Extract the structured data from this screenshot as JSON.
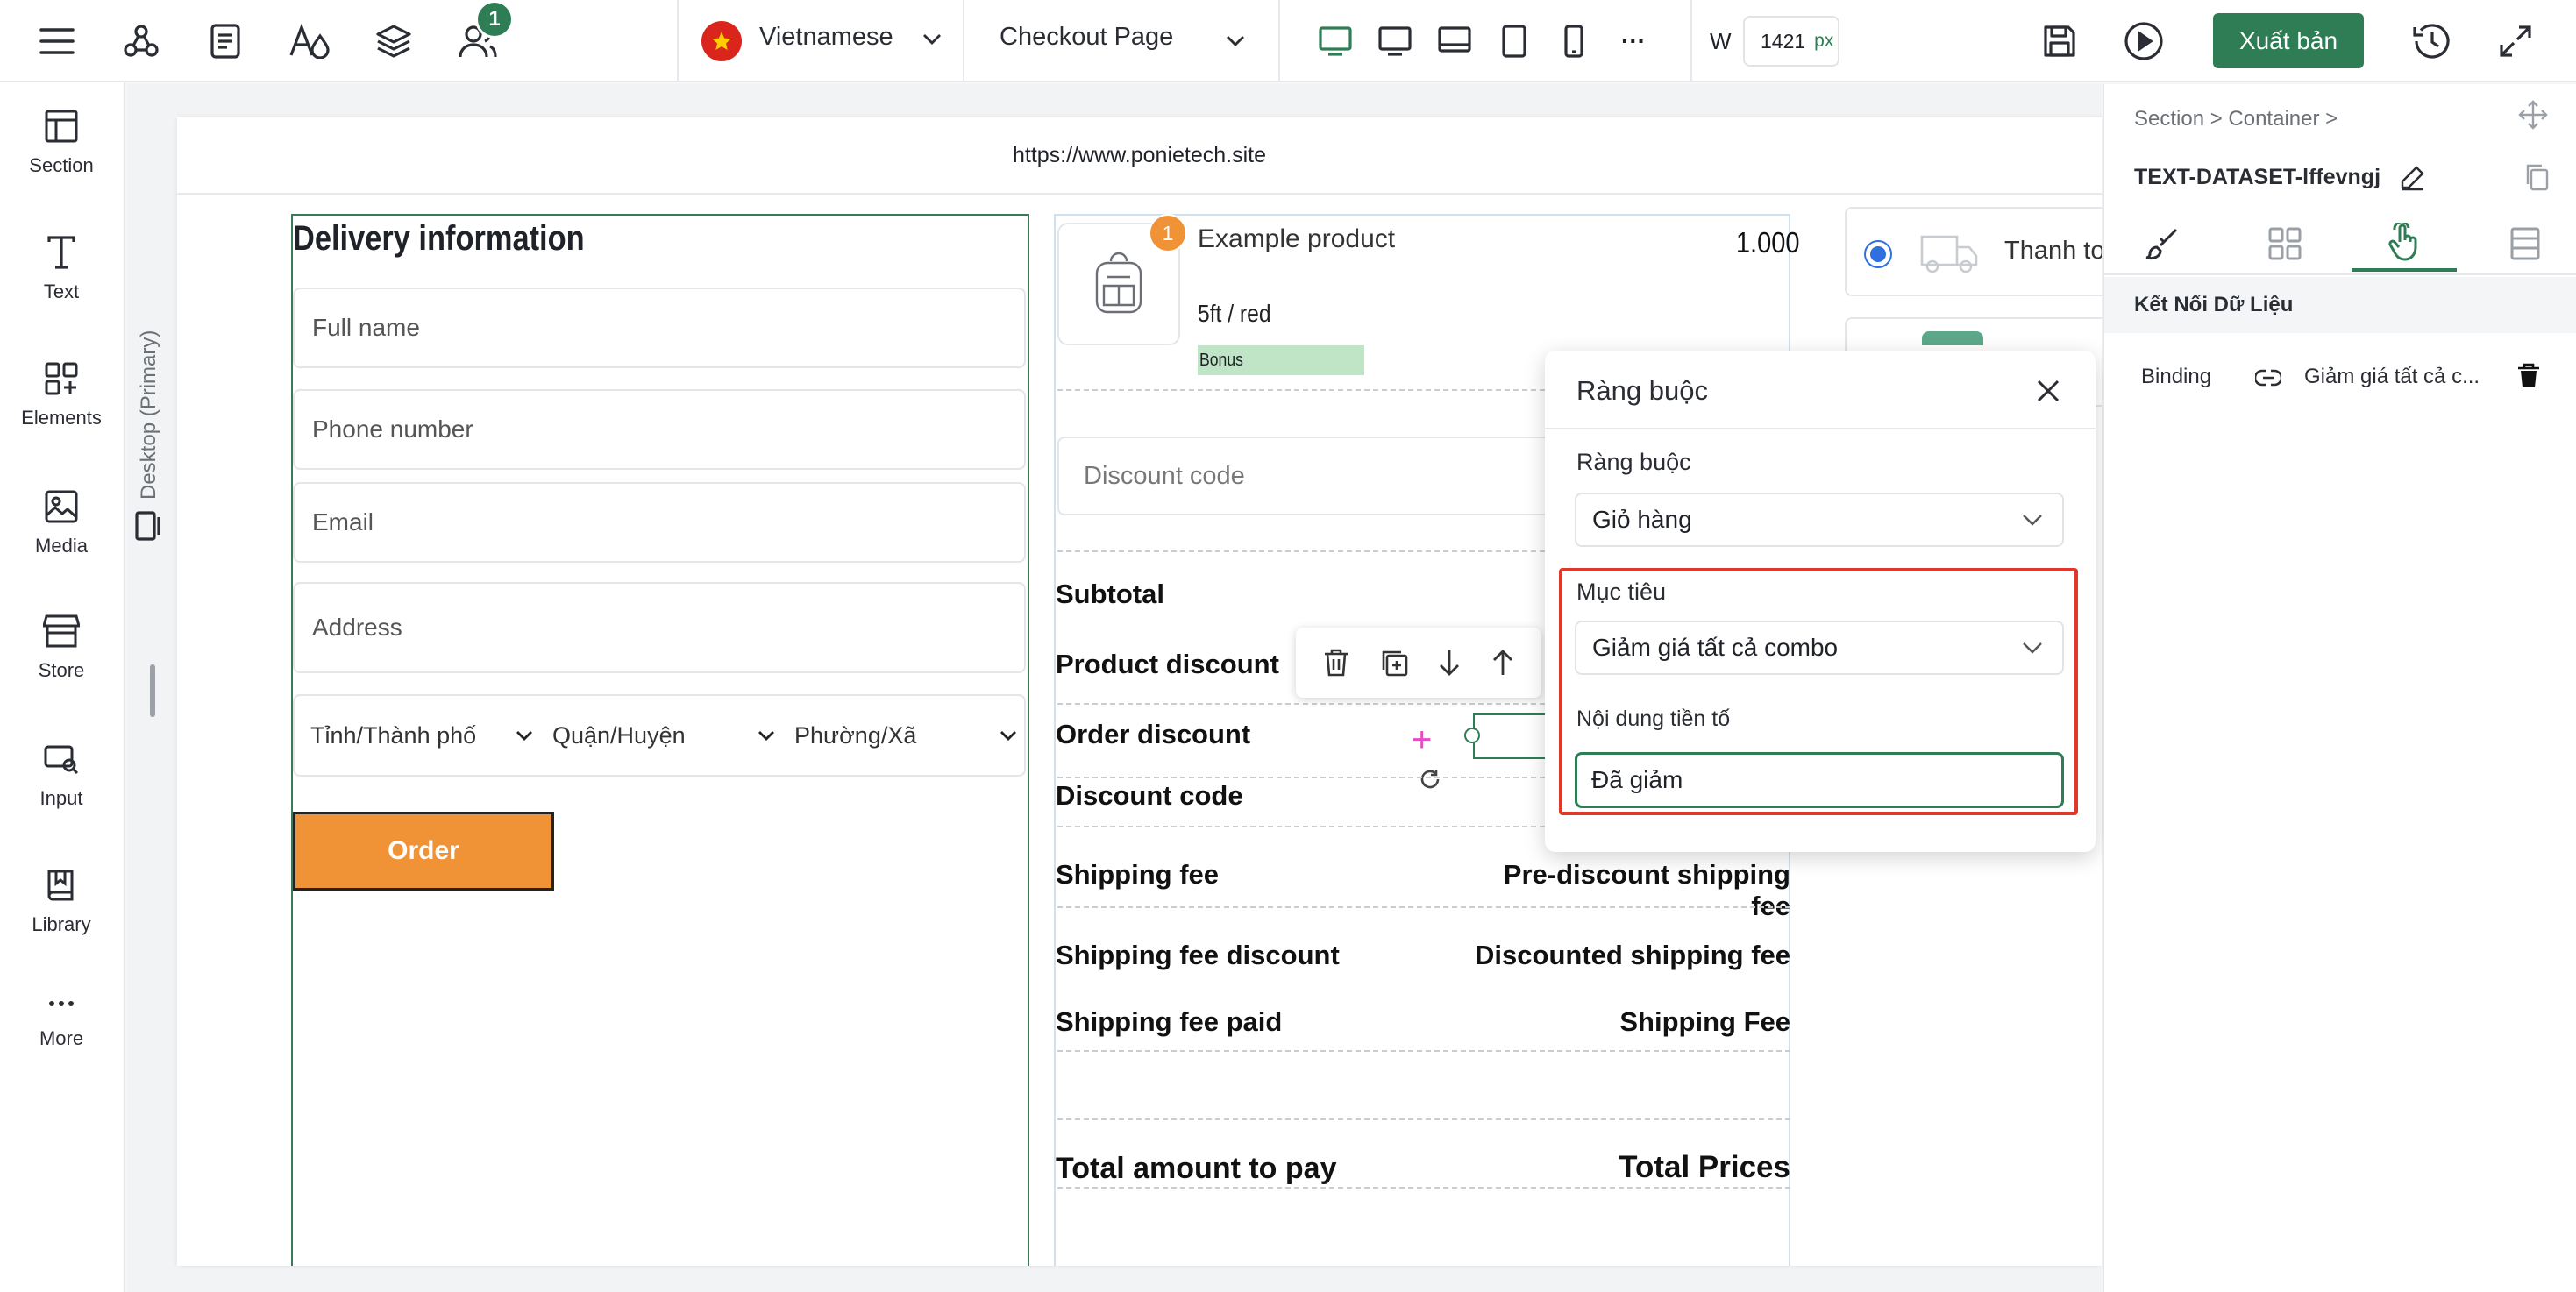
{
  "topbar": {
    "notification_count": "1",
    "language": "Vietnamese",
    "page_selector": "Checkout Page",
    "width_label": "W",
    "width_value": "1421",
    "width_unit": "px",
    "publish_label": "Xuất bản",
    "more_label": "···"
  },
  "sidebar": {
    "items": [
      {
        "label": "Section",
        "icon": "layout-icon"
      },
      {
        "label": "Text",
        "icon": "text-icon"
      },
      {
        "label": "Elements",
        "icon": "elements-icon"
      },
      {
        "label": "Media",
        "icon": "image-icon"
      },
      {
        "label": "Store",
        "icon": "store-icon"
      },
      {
        "label": "Input",
        "icon": "input-icon"
      },
      {
        "label": "Library",
        "icon": "book-icon"
      },
      {
        "label": "More",
        "icon": "more-icon"
      }
    ]
  },
  "canvas": {
    "device_label": "Desktop (Primary)",
    "url": "https://www.ponietech.site"
  },
  "delivery": {
    "title": "Delivery information",
    "full_name_placeholder": "Full name",
    "phone_placeholder": "Phone number",
    "email_placeholder": "Email",
    "address_placeholder": "Address",
    "province": "Tỉnh/Thành phố",
    "district": "Quận/Huyện",
    "ward": "Phường/Xã",
    "order_button": "Order"
  },
  "product": {
    "badge": "1",
    "name": "Example product",
    "price": "1.000",
    "variant": "5ft / red",
    "bonus": "Bonus"
  },
  "summary": {
    "discount_code_placeholder": "Discount code",
    "subtotal": "Subtotal",
    "product_discount": "Product discount",
    "order_discount": "Order discount",
    "discount_code": "Discount code",
    "shipping_fee": "Shipping fee",
    "shipping_fee_value": "Pre-discount shipping fee",
    "shipping_fee_discount": "Shipping fee discount",
    "shipping_fee_discount_value": "Discounted shipping fee",
    "shipping_fee_paid": "Shipping fee paid",
    "shipping_fee_paid_value": "Shipping Fee",
    "total_label": "Total amount to pay",
    "total_value": "Total Prices"
  },
  "payment": {
    "method_partial": "Thanh to"
  },
  "modal": {
    "title": "Ràng buộc",
    "binding_label": "Ràng buộc",
    "binding_value": "Giỏ hàng",
    "target_label": "Mục tiêu",
    "target_value": "Giảm giá tất cả combo",
    "prefix_label": "Nội dung tiền tố",
    "prefix_value": "Đã giảm"
  },
  "rightpanel": {
    "breadcrumb": "Section > Container >",
    "element_id": "TEXT-DATASET-lffevngj",
    "section_title": "Kết Nối Dữ Liệu",
    "binding_label": "Binding",
    "binding_value": "Giảm giá tất cả c..."
  },
  "colors": {
    "brand_green": "#2e7d55",
    "order_orange": "#f09236",
    "highlight_red": "#e0392b",
    "bonus_green": "#bfe5c6"
  }
}
